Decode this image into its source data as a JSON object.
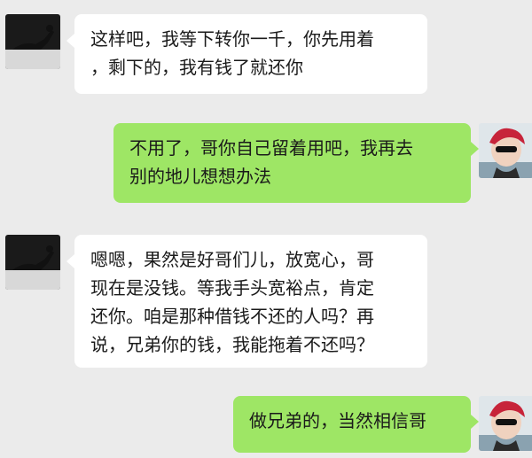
{
  "chat": {
    "messages": [
      {
        "side": "left",
        "avatar": "friend-avatar",
        "lines": [
          "这样吧，我等下转你一千，你先用着",
          "，剩下的，我有钱了就还你"
        ]
      },
      {
        "side": "right",
        "avatar": "user-avatar",
        "lines": [
          "不用了，哥你自己留着用吧，我再去",
          "别的地儿想想办法"
        ]
      },
      {
        "side": "left",
        "avatar": "friend-avatar",
        "lines": [
          "嗯嗯，果然是好哥们儿，放宽心，哥",
          "现在是没钱。等我手头宽裕点，肯定",
          "还你。咱是那种借钱不还的人吗？再",
          "说，兄弟你的钱，我能拖着不还吗？"
        ]
      },
      {
        "side": "right",
        "avatar": "user-avatar",
        "lines": [
          "做兄弟的，当然相信哥"
        ]
      }
    ]
  },
  "colors": {
    "background": "#ebebeb",
    "incoming_bubble": "#ffffff",
    "outgoing_bubble": "#9ee665"
  }
}
